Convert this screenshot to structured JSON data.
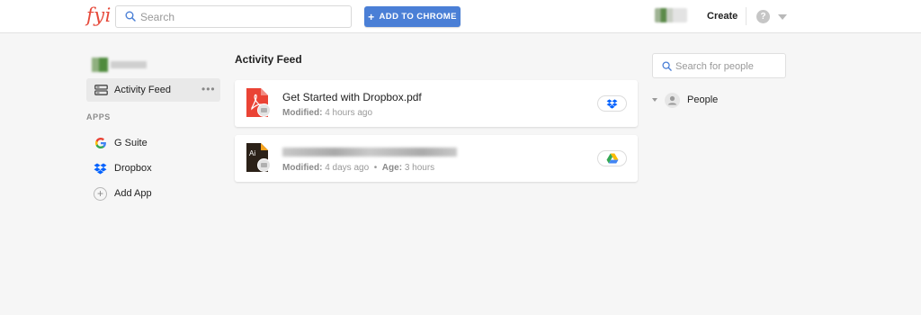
{
  "header": {
    "logo": "fyi",
    "search_placeholder": "Search",
    "add_to_chrome": "ADD TO CHROME",
    "create": "Create",
    "help": "?"
  },
  "sidebar": {
    "activity_feed": "Activity Feed",
    "more": "•••",
    "apps_heading": "APPS",
    "apps": [
      {
        "label": "G Suite",
        "icon": "google-icon"
      },
      {
        "label": "Dropbox",
        "icon": "dropbox-icon"
      },
      {
        "label": "Add App",
        "icon": "plus-icon"
      }
    ]
  },
  "feed": {
    "title": "Activity Feed",
    "items": [
      {
        "name": "Get Started with Dropbox.pdf",
        "modified_label": "Modified:",
        "modified": "4 hours ago",
        "file_icon": "pdf-file-icon",
        "source_icon": "dropbox-icon"
      },
      {
        "name": "",
        "modified_label": "Modified:",
        "modified": "4 days ago",
        "separator": "•",
        "age_label": "Age:",
        "age": "3 hours",
        "file_icon": "illustrator-file-icon",
        "source_icon": "google-drive-icon"
      }
    ]
  },
  "people": {
    "search_placeholder": "Search for people",
    "label": "People"
  },
  "colors": {
    "brand": "#e64a3b",
    "accent": "#4a7fd6",
    "dropbox": "#0061fe"
  }
}
